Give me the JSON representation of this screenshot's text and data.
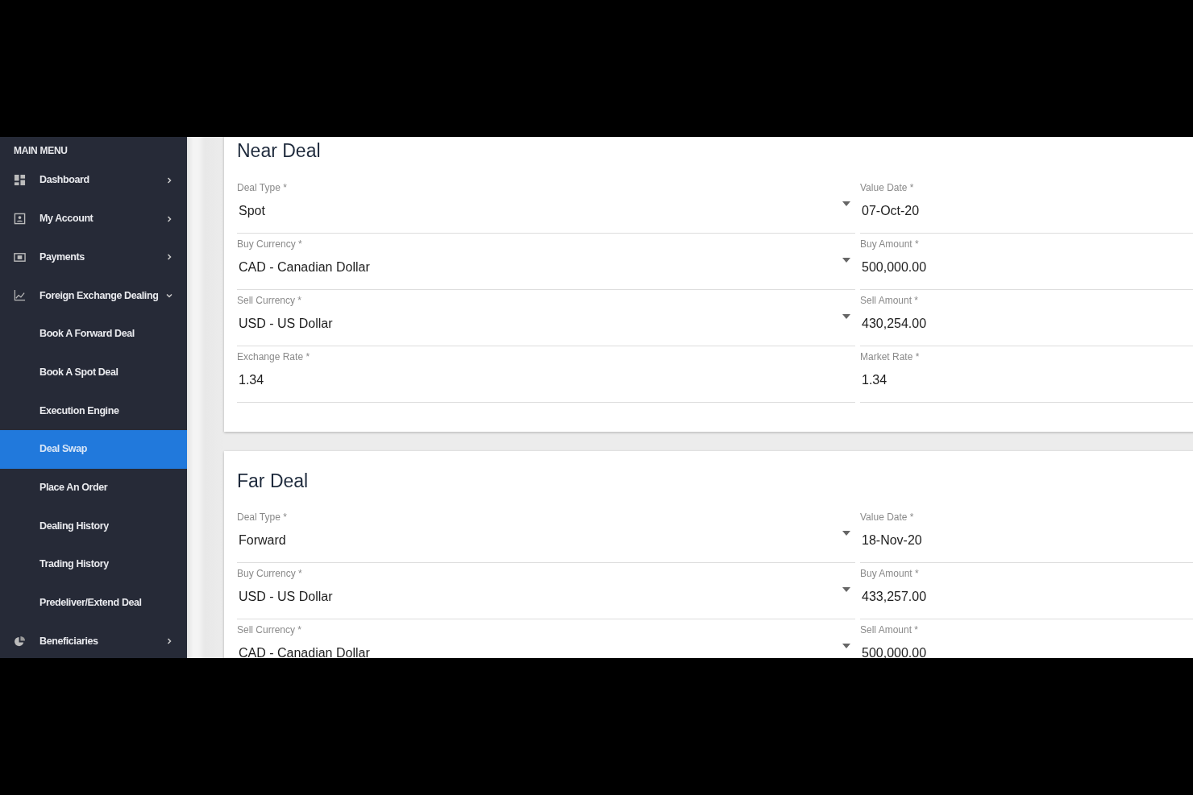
{
  "sidebar": {
    "heading": "MAIN MENU",
    "items": [
      {
        "label": "Dashboard",
        "expanded": false,
        "selected": false
      },
      {
        "label": "My Account",
        "expanded": false,
        "selected": false
      },
      {
        "label": "Payments",
        "expanded": false,
        "selected": false
      },
      {
        "label": "Foreign Exchange Dealing",
        "expanded": true,
        "selected": false,
        "children": [
          {
            "label": "Book A Forward Deal",
            "selected": false
          },
          {
            "label": "Book A Spot Deal",
            "selected": false
          },
          {
            "label": "Execution Engine",
            "selected": false
          },
          {
            "label": "Deal Swap",
            "selected": true
          },
          {
            "label": "Place An Order",
            "selected": false
          },
          {
            "label": "Dealing History",
            "selected": false
          },
          {
            "label": "Trading History",
            "selected": false
          },
          {
            "label": "Predeliver/Extend Deal",
            "selected": false
          }
        ]
      },
      {
        "label": "Beneficiaries",
        "expanded": false,
        "selected": false
      }
    ]
  },
  "sections": [
    {
      "title": "Near Deal",
      "fields": [
        {
          "label": "Deal Type *",
          "value": "Spot",
          "kind": "select"
        },
        {
          "label": "Value Date *",
          "value": "07-Oct-20",
          "kind": "text"
        },
        {
          "label": "Buy Currency *",
          "value": "CAD - Canadian Dollar",
          "kind": "select"
        },
        {
          "label": "Buy Amount *",
          "value": "500,000.00",
          "kind": "text"
        },
        {
          "label": "Sell Currency *",
          "value": "USD - US Dollar",
          "kind": "select"
        },
        {
          "label": "Sell Amount *",
          "value": "430,254.00",
          "kind": "text"
        },
        {
          "label": "Exchange Rate *",
          "value": "1.34",
          "kind": "text"
        },
        {
          "label": "Market Rate *",
          "value": "1.34",
          "kind": "text"
        }
      ]
    },
    {
      "title": "Far Deal",
      "fields": [
        {
          "label": "Deal Type *",
          "value": "Forward",
          "kind": "select"
        },
        {
          "label": "Value Date *",
          "value": "18-Nov-20",
          "kind": "text"
        },
        {
          "label": "Buy Currency *",
          "value": "USD - US Dollar",
          "kind": "select"
        },
        {
          "label": "Buy Amount *",
          "value": "433,257.00",
          "kind": "text"
        },
        {
          "label": "Sell Currency *",
          "value": "CAD - Canadian Dollar",
          "kind": "select"
        },
        {
          "label": "Sell Amount *",
          "value": "500,000.00",
          "kind": "text"
        }
      ]
    }
  ]
}
